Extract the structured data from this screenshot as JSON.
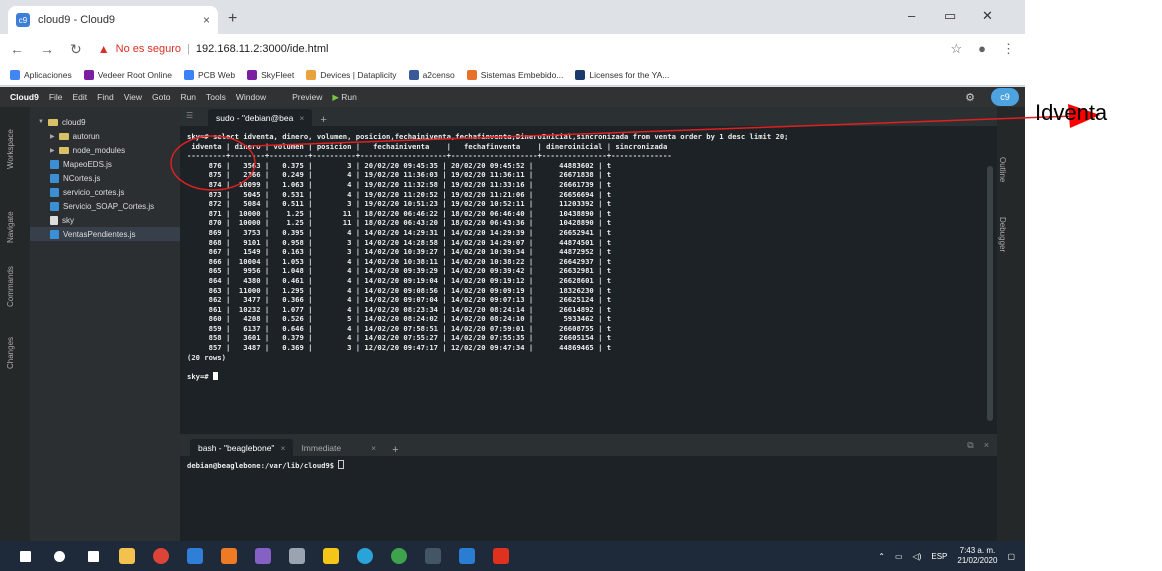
{
  "browser": {
    "tab_title": "cloud9 - Cloud9",
    "tab_close": "×",
    "new_tab": "+",
    "controls": {
      "minimize": "–",
      "maximize": "▭",
      "close": "✕"
    },
    "security_label": "No es seguro",
    "url": "192.168.11.2:3000/ide.html",
    "bookmarks": [
      {
        "label": "Aplicaciones",
        "color": "#4285f4"
      },
      {
        "label": "Vedeer Root Online",
        "color": "#7b1fa2"
      },
      {
        "label": "PCB Web",
        "color": "#3b82f6"
      },
      {
        "label": "SkyFleet",
        "color": "#7b1fa2"
      },
      {
        "label": "Devices | Dataplicity",
        "color": "#e8a33d"
      },
      {
        "label": "a2censo",
        "color": "#3b5998"
      },
      {
        "label": "Sistemas Embebido...",
        "color": "#e8702a"
      },
      {
        "label": "Licenses for the YA...",
        "color": "#1a3a6b"
      }
    ]
  },
  "ide": {
    "menu": {
      "brand": "Cloud9",
      "items": [
        "File",
        "Edit",
        "Find",
        "View",
        "Goto",
        "Run",
        "Tools",
        "Window"
      ],
      "preview": "Preview",
      "run": "Run"
    },
    "left_tabs": [
      "Workspace",
      "Navigate",
      "Commands",
      "Changes"
    ],
    "right_tabs": [
      "Outline",
      "Debugger"
    ],
    "tree": [
      {
        "label": "cloud9",
        "type": "folder",
        "level": 0,
        "open": true
      },
      {
        "label": "autorun",
        "type": "folder",
        "level": 1,
        "open": false
      },
      {
        "label": "node_modules",
        "type": "folder",
        "level": 1,
        "open": false
      },
      {
        "label": "MapeoEDS.js",
        "type": "js",
        "level": 1
      },
      {
        "label": "NCortes.js",
        "type": "js",
        "level": 1
      },
      {
        "label": "servicio_cortes.js",
        "type": "js",
        "level": 1
      },
      {
        "label": "Servicio_SOAP_Cortes.js",
        "type": "js",
        "level": 1
      },
      {
        "label": "sky",
        "type": "file",
        "level": 1
      },
      {
        "label": "VentasPendientes.js",
        "type": "js",
        "level": 1,
        "selected": true
      }
    ],
    "term1_tab": "sudo - \"debian@bea",
    "term1_lines": [
      "sky=# select idventa, dinero, volumen, posicion,fechainiventa,fechafinventa,DineroInicial,sincronizada from venta order by 1 desc limit 20;",
      " idventa | dinero | volumen | posicion |   fechainiventa    |   fechafinventa    | dineroinicial | sincronizada",
      "---------+--------+---------+----------+--------------------+--------------------+---------------+--------------",
      "     876 |   3563 |   0.375 |        3 | 20/02/20 09:45:35 | 20/02/20 09:45:52 |      44883602 | t",
      "     875 |   2366 |   0.249 |        4 | 19/02/20 11:36:03 | 19/02/20 11:36:11 |      26671838 | t",
      "     874 |  10099 |   1.063 |        4 | 19/02/20 11:32:58 | 19/02/20 11:33:16 |      26661739 | t",
      "     873 |   5045 |   0.531 |        4 | 19/02/20 11:20:52 | 19/02/20 11:21:06 |      26656694 | t",
      "     872 |   5084 |   0.511 |        3 | 19/02/20 10:51:23 | 19/02/20 10:52:11 |      11203392 | t",
      "     871 |  10000 |    1.25 |       11 | 18/02/20 06:46:22 | 18/02/20 06:46:40 |      10438890 | t",
      "     870 |  10000 |    1.25 |       11 | 18/02/20 06:43:20 | 18/02/20 06:43:36 |      10428890 | t",
      "     869 |   3753 |   0.395 |        4 | 14/02/20 14:29:31 | 14/02/20 14:29:39 |      26652941 | t",
      "     868 |   9101 |   0.958 |        3 | 14/02/20 14:28:58 | 14/02/20 14:29:07 |      44874501 | t",
      "     867 |   1549 |   0.163 |        3 | 14/02/20 10:39:27 | 14/02/20 10:39:34 |      44872952 | t",
      "     866 |  10004 |   1.053 |        4 | 14/02/20 10:38:11 | 14/02/20 10:38:22 |      26642937 | t",
      "     865 |   9956 |   1.048 |        4 | 14/02/20 09:39:29 | 14/02/20 09:39:42 |      26632981 | t",
      "     864 |   4380 |   0.461 |        4 | 14/02/20 09:19:04 | 14/02/20 09:19:12 |      26628601 | t",
      "     863 |  11000 |   1.295 |        4 | 14/02/20 09:08:56 | 14/02/20 09:09:19 |      18326230 | t",
      "     862 |   3477 |   0.366 |        4 | 14/02/20 09:07:04 | 14/02/20 09:07:13 |      26625124 | t",
      "     861 |  10232 |   1.077 |        4 | 14/02/20 08:23:34 | 14/02/20 08:24:14 |      26614892 | t",
      "     860 |   4208 |   0.526 |        5 | 14/02/20 08:24:02 | 14/02/20 08:24:10 |       5933462 | t",
      "     859 |   6137 |   0.646 |        4 | 14/02/20 07:58:51 | 14/02/20 07:59:01 |      26608755 | t",
      "     858 |   3601 |   0.379 |        4 | 14/02/20 07:55:27 | 14/02/20 07:55:35 |      26605154 | t",
      "     857 |   3487 |   0.369 |        3 | 12/02/20 09:47:17 | 12/02/20 09:47:34 |      44869465 | t",
      "(20 rows)",
      "",
      "sky=# "
    ],
    "term2_tab": "bash - \"beaglebone\"",
    "term2_tab2": "Immediate",
    "term2_prompt": "debian@beaglebone:/var/lib/cloud9$ "
  },
  "taskbar": {
    "icons": [
      {
        "name": "start-icon",
        "color": "#ffffff"
      },
      {
        "name": "search-icon",
        "color": "#ffffff"
      },
      {
        "name": "task-view-icon",
        "color": "#ffffff"
      },
      {
        "name": "file-explorer-icon",
        "color": "#f2c14e"
      },
      {
        "name": "chrome-icon",
        "color": "#db4437"
      },
      {
        "name": "app-blue-icon",
        "color": "#2f7fd8"
      },
      {
        "name": "app-orange-icon",
        "color": "#ee7a23"
      },
      {
        "name": "visual-studio-icon",
        "color": "#8661c5"
      },
      {
        "name": "app-calc-icon",
        "color": "#9aa4b0"
      },
      {
        "name": "app-yellow-icon",
        "color": "#f5c518"
      },
      {
        "name": "edge-icon",
        "color": "#2aa3d8"
      },
      {
        "name": "app-green-icon",
        "color": "#3fa34d"
      },
      {
        "name": "terminal-icon",
        "color": "#445566"
      },
      {
        "name": "app-doc-icon",
        "color": "#2b7cd3"
      },
      {
        "name": "acrobat-icon",
        "color": "#e0301e"
      }
    ],
    "lang": "ESP",
    "time": "7:43 a. m.",
    "date": "21/02/2020"
  },
  "annotation": {
    "label": "Idventa",
    "color": "#ff0000"
  }
}
